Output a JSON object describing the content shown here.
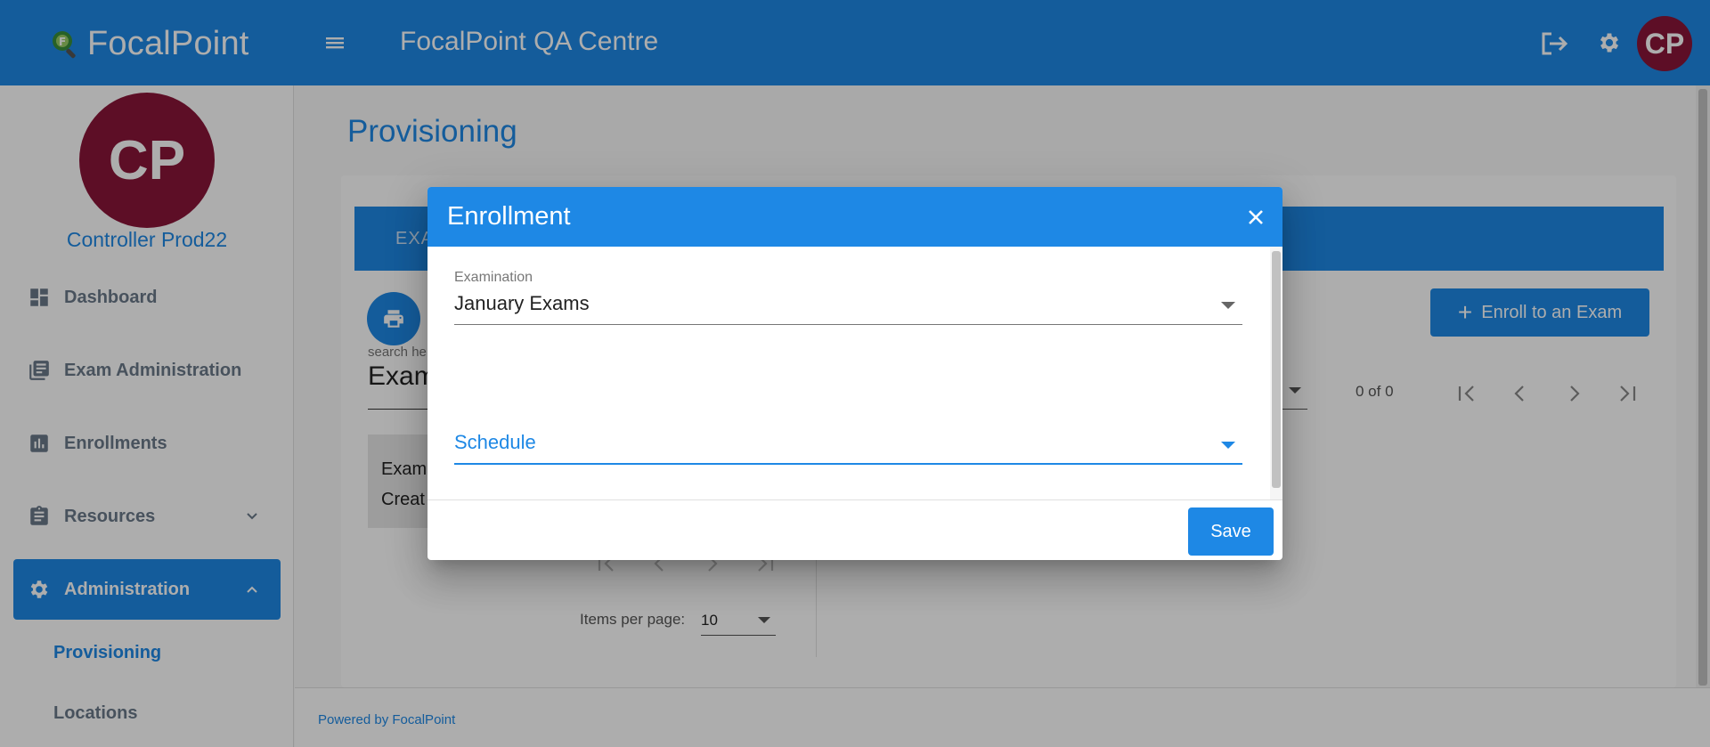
{
  "header": {
    "brand": "FocalPoint",
    "app_title": "FocalPoint QA Centre",
    "avatar_initials": "CP"
  },
  "sidebar": {
    "avatar_initials": "CP",
    "user_name": "Controller Prod22",
    "items": [
      {
        "label": "Dashboard",
        "icon": "dashboard-icon"
      },
      {
        "label": "Exam Administration",
        "icon": "library-books-icon"
      },
      {
        "label": "Enrollments",
        "icon": "bar-chart-icon"
      },
      {
        "label": "Resources",
        "icon": "clipboard-icon",
        "expandable": true
      },
      {
        "label": "Administration",
        "icon": "gear-icon",
        "expanded": true,
        "active": true
      }
    ],
    "sub_items": [
      {
        "label": "Provisioning",
        "active": true
      },
      {
        "label": "Locations",
        "active": false
      }
    ]
  },
  "main": {
    "page_title": "Provisioning",
    "tab_label": "EXA",
    "search_label": "search he",
    "search_value": "Exam",
    "list_item_lines": [
      "Exam",
      "Creat"
    ],
    "items_per_page_label": "Items per page:",
    "items_per_page_value": "10",
    "enroll_button": "Enroll to an Exam",
    "range_text": "0 of 0"
  },
  "footer": {
    "text": "Powered by FocalPoint"
  },
  "dialog": {
    "title": "Enrollment",
    "examination_label": "Examination",
    "examination_value": "January Exams",
    "schedule_placeholder": "Schedule",
    "save_label": "Save"
  },
  "colors": {
    "primary": "#1e88e5",
    "avatar": "#8a1538",
    "nav_text": "#6b7a8a"
  }
}
